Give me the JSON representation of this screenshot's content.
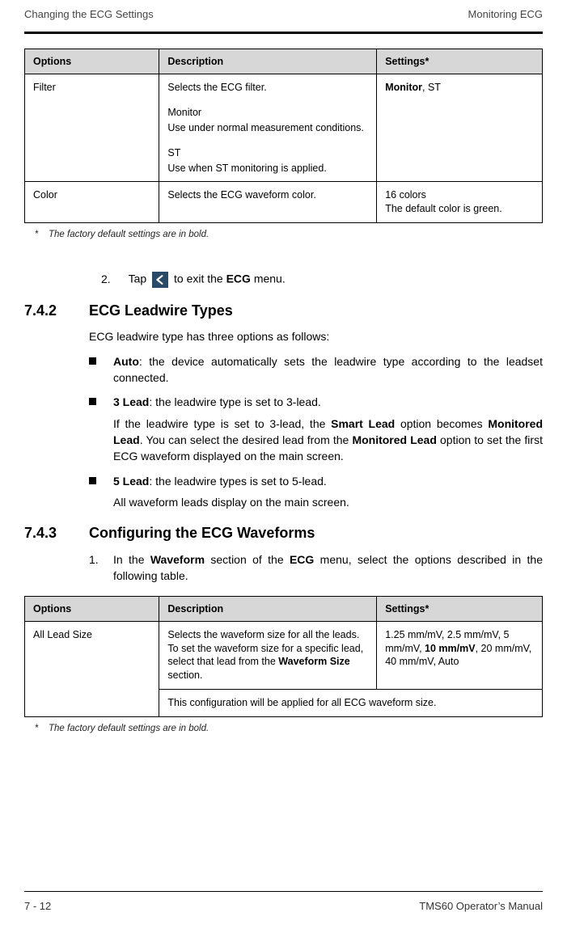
{
  "header": {
    "left": "Changing the ECG Settings",
    "right": "Monitoring ECG"
  },
  "table1": {
    "headers": {
      "options": "Options",
      "description": "Description",
      "settings": "Settings*"
    },
    "rows": [
      {
        "option": "Filter",
        "desc_intro": "Selects the ECG filter.",
        "desc_m_title": "Monitor",
        "desc_m_body": "Use under normal measurement conditions.",
        "desc_s_title": "ST",
        "desc_s_body": "Use when ST monitoring is applied.",
        "settings_bold": "Monitor",
        "settings_rest": ", ST"
      },
      {
        "option": "Color",
        "desc": "Selects the ECG waveform color.",
        "settings_l1": "16 colors",
        "settings_l2": "The default color is green."
      }
    ],
    "footnote": "The factory default settings are in bold."
  },
  "step2": {
    "num": "2.",
    "pre": "Tap ",
    "post": " to exit the ",
    "target": "ECG",
    "end": " menu."
  },
  "sec742": {
    "num": "7.4.2",
    "title": "ECG Leadwire Types",
    "intro": "ECG leadwire type has three options as follows:",
    "items": [
      {
        "lead": "Auto",
        "rest": ": the device automatically sets the leadwire type according to the leadset connected."
      },
      {
        "lead": "3 Lead",
        "rest": ": the leadwire type is set to 3-lead.",
        "sub_pre": "If the leadwire type is set to 3-lead, the ",
        "sub_b1": "Smart Lead",
        "sub_mid1": " option becomes ",
        "sub_b2": "Monitored Lead",
        "sub_mid2": ". You can select the desired lead from the ",
        "sub_b3": "Monitored Lead",
        "sub_end": " option to set the first ECG waveform displayed on the main screen."
      },
      {
        "lead": "5 Lead",
        "rest": ": the leadwire types is set to 5-lead.",
        "sub_plain": "All waveform leads display on the main screen."
      }
    ]
  },
  "sec743": {
    "num": "7.4.3",
    "title": "Configuring the ECG Waveforms",
    "step1_num": "1.",
    "step1_pre": "In the ",
    "step1_b1": "Waveform",
    "step1_mid": " section of the ",
    "step1_b2": "ECG",
    "step1_end": " menu, select the options described in the following table."
  },
  "table2": {
    "headers": {
      "options": "Options",
      "description": "Description",
      "settings": "Settings*"
    },
    "row": {
      "option": "All Lead Size",
      "desc_l1": "Selects the waveform size for all the leads.",
      "desc_l2_pre": "To set the waveform size for a specific lead, select that lead from the ",
      "desc_l2_b": "Waveform Size",
      "desc_l2_post": " section.",
      "settings_pre": "1.25 mm/mV, 2.5 mm/mV, 5 mm/mV, ",
      "settings_bold": "10 mm/mV",
      "settings_post": ", 20 mm/mV, 40 mm/mV, Auto",
      "note": "This configuration will be applied for all ECG waveform size."
    },
    "footnote": "The factory default settings are in bold."
  },
  "footer": {
    "left": "7 - 12",
    "right": "TMS60 Operator’s Manual"
  }
}
